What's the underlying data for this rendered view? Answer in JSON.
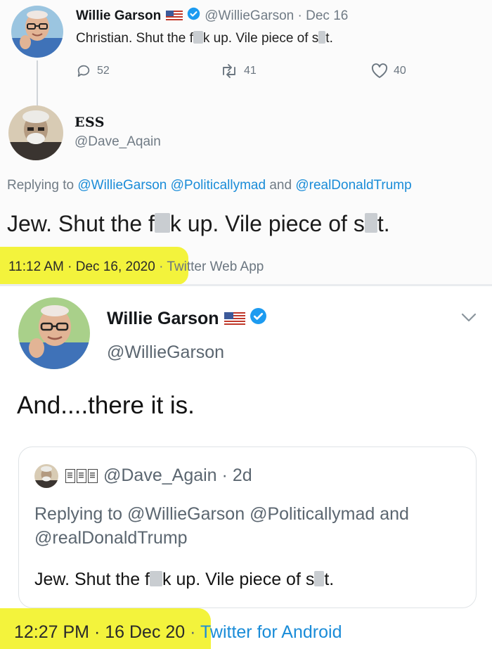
{
  "tweet1": {
    "name": "Willie Garson",
    "handle": "@WillieGarson",
    "date": "Dec 16",
    "text_part1": "Christian. Shut the f",
    "text_part2": "k up. Vile piece of s",
    "text_part3": "t.",
    "replies": "52",
    "retweets": "41",
    "likes": "40",
    "icons": [
      "flag-us-icon",
      "verified-badge-icon",
      "reply-icon",
      "retweet-icon",
      "like-icon"
    ]
  },
  "tweet2": {
    "name": "ESS",
    "handle": "@Dave_Aqain",
    "replying_label": "Replying to",
    "replying_to": [
      "@WillieGarson",
      "@Politicallymad",
      "@realDonaldTrump"
    ],
    "and_label": "and",
    "text_part1": "Jew. Shut the f",
    "text_part2": "k up. Vile piece of s",
    "text_part3": "t.",
    "time": "11:12 AM",
    "date": "Dec 16, 2020",
    "client": "Twitter Web App"
  },
  "tweet3": {
    "name": "Willie Garson",
    "handle": "@WillieGarson",
    "text": "And....there it is.",
    "time": "12:27 PM",
    "date": "16 Dec 20",
    "client": "Twitter for Android"
  },
  "quoted": {
    "handle": "@Dave_Again",
    "age": "2d",
    "replying_label": "Replying to",
    "replying_to": [
      "@WillieGarson",
      "@Politicallymad",
      "@realDonaldTrump"
    ],
    "and_label": "and",
    "text_part1": "Jew. Shut the f",
    "text_part2": "k up. Vile piece of s",
    "text_part3": "t."
  },
  "colors": {
    "highlight": "#f3f33c",
    "link": "#1a8cd8",
    "verified": "#1d9bf0",
    "muted": "#707b85"
  }
}
